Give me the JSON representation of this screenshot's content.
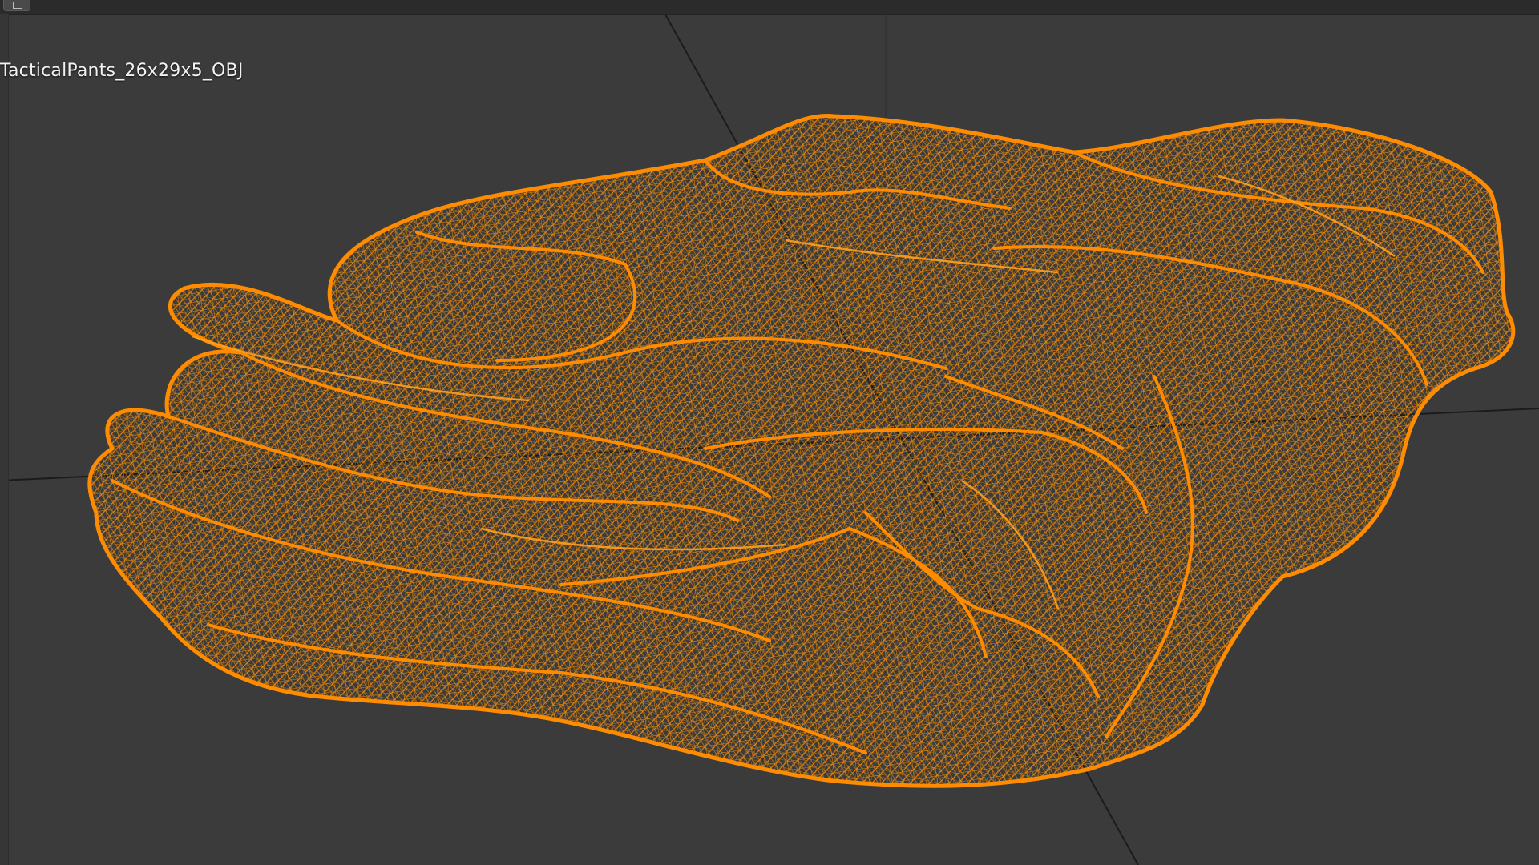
{
  "viewport": {
    "object_name": "TacticalPants_26x29x5_OBJ",
    "background_color": "#3b3b3b",
    "grid_line_color": "#1e1e1e",
    "wireframe_color": "#ff8c00"
  },
  "header": {
    "editor_type_button_icon": "editor-type-icon"
  }
}
